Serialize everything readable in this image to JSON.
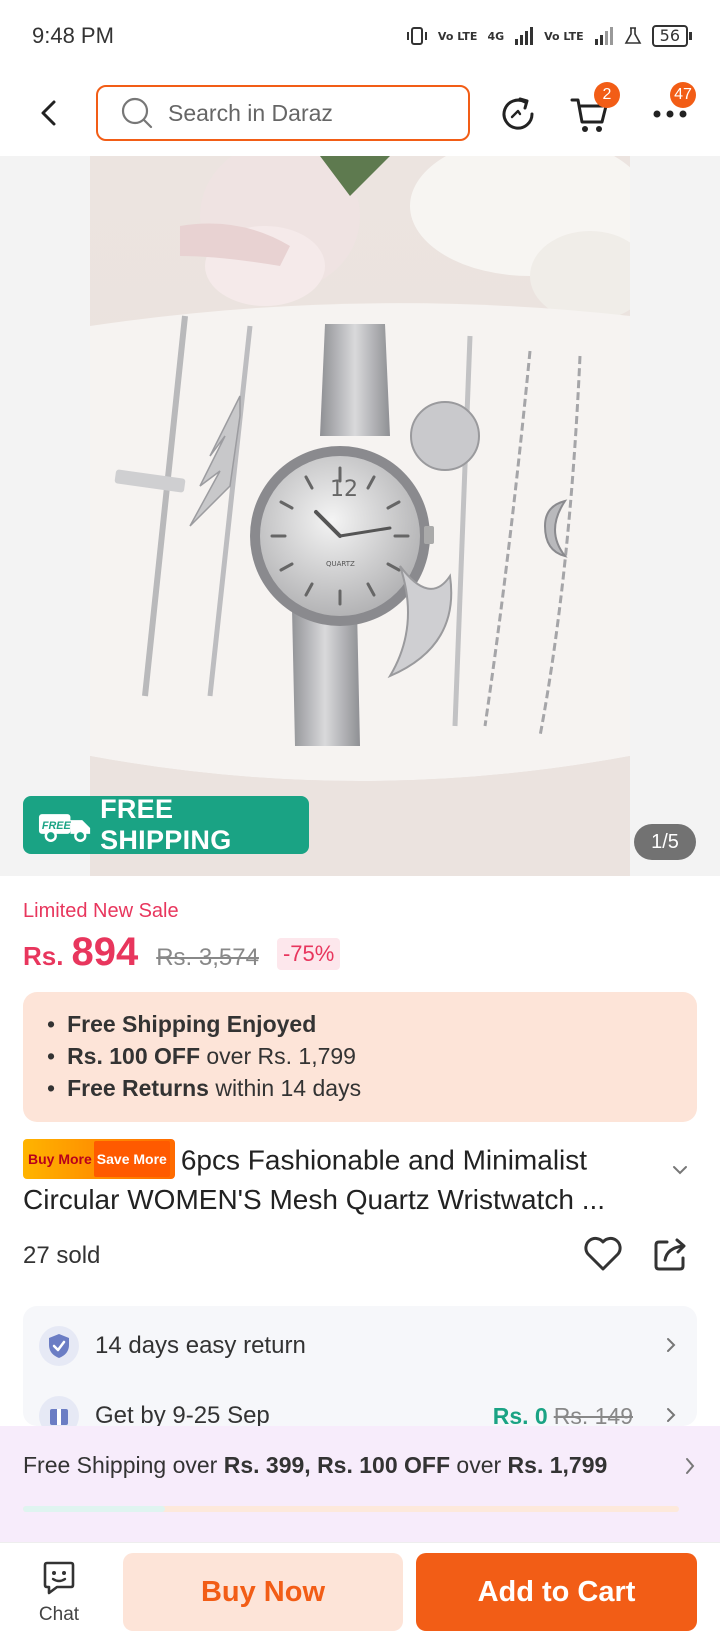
{
  "status_bar": {
    "time": "9:48 PM",
    "network_1": "Vo LTE",
    "network_2": "4G",
    "network_3": "Vo LTE",
    "battery": "56"
  },
  "header": {
    "search_placeholder": "Search in Daraz",
    "cart_badge": "2",
    "more_badge": "47"
  },
  "gallery": {
    "free_shipping_badge": "FREE",
    "free_shipping_label": "FREE SHIPPING",
    "page_indicator": "1/5",
    "watch_dial_text": "QUARTZ",
    "watch_numeral": "12"
  },
  "pricing": {
    "sale_label": "Limited New Sale",
    "currency": "Rs.",
    "price": "894",
    "original_price": "Rs. 3,574",
    "discount": "-75%",
    "accent_color": "#e8365d"
  },
  "benefits": [
    {
      "bold": "Free Shipping Enjoyed",
      "rest": ""
    },
    {
      "bold": "Rs. 100 OFF",
      "rest": " over Rs. 1,799"
    },
    {
      "bold": "Free Returns",
      "rest": " within 14 days"
    }
  ],
  "product": {
    "promo_tag_1": "Buy More",
    "promo_tag_2": "Save More",
    "title": "6pcs Fashionable and Minimalist Circular WOMEN'S Mesh Quartz Wristwatch ...",
    "sold": "27 sold"
  },
  "services": {
    "return_text": "14 days easy return",
    "delivery_text": "Get by 9-25 Sep",
    "delivery_price": "Rs. 0",
    "delivery_old_price": "Rs. 149"
  },
  "shipping_strip": {
    "prefix": "Free Shipping over ",
    "threshold_1": "Rs. 399, Rs. 100 OFF",
    "middle": " over ",
    "threshold_2": "Rs. 1,799"
  },
  "bottom_bar": {
    "chat_label": "Chat",
    "buy_now": "Buy Now",
    "add_to_cart": "Add to Cart",
    "brand_color": "#f25d16"
  }
}
